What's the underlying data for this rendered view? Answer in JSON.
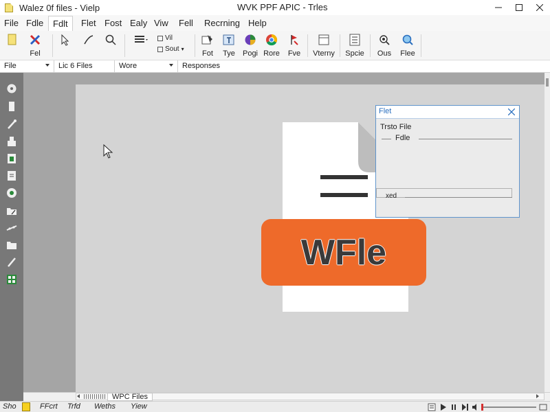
{
  "titlebar": {
    "left_title": "Walez  0f files  -  Vielp",
    "center_title": "WVK PPF APIC - Trles"
  },
  "menu": {
    "items": [
      "File",
      "Fdle",
      "Fdlt",
      "Flet",
      "Fost",
      "Ealy",
      "Viw",
      "Fell",
      "Recrning",
      "Help"
    ],
    "active_index": 2
  },
  "toolbar": {
    "buttons": [
      {
        "label": "",
        "icon": "new-file-icon"
      },
      {
        "label": "Fel",
        "icon": "cut-icon"
      },
      {
        "label": "",
        "icon": "arrow-cursor-icon"
      },
      {
        "label": "",
        "icon": "pen-icon"
      },
      {
        "label": "",
        "icon": "search-icon"
      },
      {
        "label": "",
        "icon": "list-icon"
      },
      {
        "label": "Fot",
        "icon": "font-icon"
      },
      {
        "label": "Tye",
        "icon": "type-icon"
      },
      {
        "label": "Pogi",
        "icon": "globe-icon"
      },
      {
        "label": "Rore",
        "icon": "chrome-icon"
      },
      {
        "label": "Fve",
        "icon": "flag-icon"
      },
      {
        "label": "Vterny",
        "icon": "window-icon"
      },
      {
        "label": "Spcie",
        "icon": "grid-icon"
      },
      {
        "label": "Ous",
        "icon": "gear-icon"
      },
      {
        "label": "Flee",
        "icon": "magnifier-icon"
      }
    ],
    "small_top": "Vil",
    "small_bottom": "Sout"
  },
  "columns": [
    "File",
    "Lic 6 Files",
    "Wore",
    "Responses"
  ],
  "dialog": {
    "title": "Flet",
    "label_1": "Trsto File",
    "label_2": "Fdle",
    "label_3": "xed"
  },
  "graphic": {
    "banner_text": "WFle",
    "accent_color": "#ee6a2a"
  },
  "tabbar": {
    "tab_label": "WPC Files"
  },
  "statusbar": {
    "left_label": "Sho",
    "items": [
      "FFcrt",
      "Trfd",
      "Weths",
      "Yiew"
    ]
  }
}
